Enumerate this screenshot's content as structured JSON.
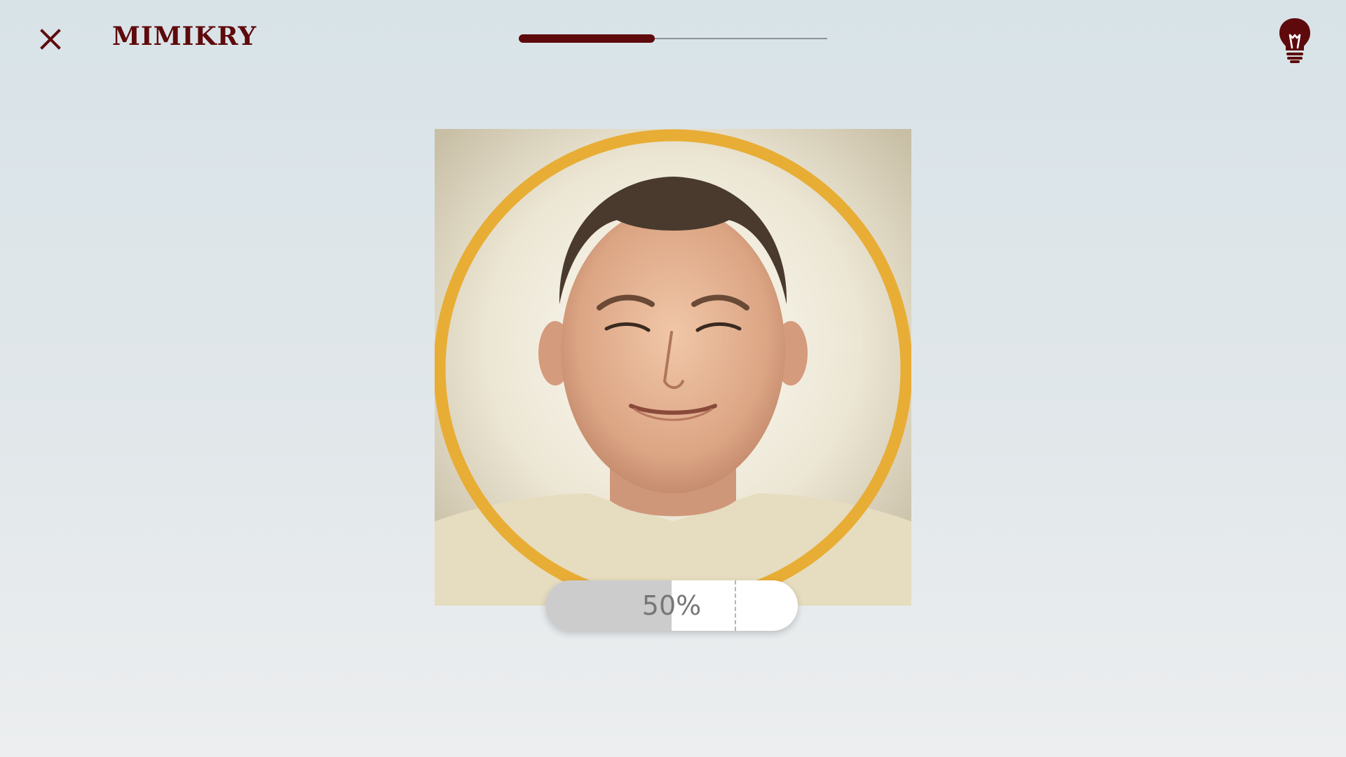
{
  "header": {
    "title": "MIMIKRY",
    "close_icon": "close-icon",
    "hint_icon": "lightbulb-icon"
  },
  "progress": {
    "fraction": 0.44
  },
  "match": {
    "percent_label": "50%",
    "fraction": 0.5,
    "target_fraction": 0.75
  },
  "colors": {
    "brand": "#5e0a0c",
    "ring": "#e8ad35",
    "meter_fill": "#cccccc"
  }
}
